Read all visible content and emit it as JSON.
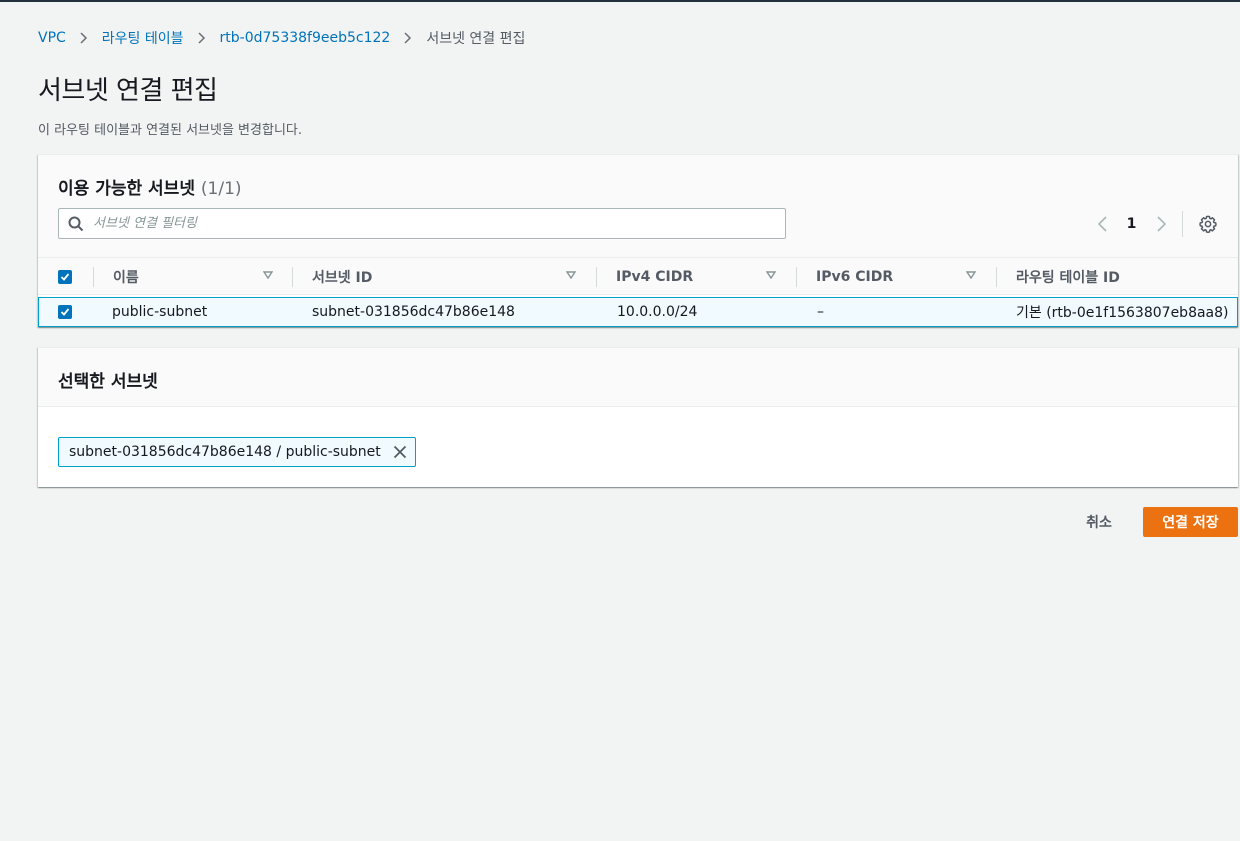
{
  "breadcrumb": {
    "items": [
      "VPC",
      "라우팅 테이블",
      "rtb-0d75338f9eeb5c122"
    ],
    "current": "서브넷 연결 편집"
  },
  "page": {
    "title": "서브넷 연결 편집",
    "description": "이 라우팅 테이블과 연결된 서브넷을 변경합니다."
  },
  "available_subnets": {
    "title": "이용 가능한 서브넷",
    "count": "(1/1)",
    "search_placeholder": "서브넷 연결 필터링",
    "page_number": "1",
    "columns": [
      "이름",
      "서브넷 ID",
      "IPv4 CIDR",
      "IPv6 CIDR",
      "라우팅 테이블 ID"
    ],
    "rows": [
      {
        "checked": true,
        "name": "public-subnet",
        "subnet_id": "subnet-031856dc47b86e148",
        "ipv4_cidr": "10.0.0.0/24",
        "ipv6_cidr": "–",
        "route_table_id": "기본 (rtb-0e1f1563807eb8aa8)"
      }
    ]
  },
  "selected_subnets": {
    "title": "선택한 서브넷",
    "tokens": [
      "subnet-031856dc47b86e148 / public-subnet"
    ]
  },
  "actions": {
    "cancel_label": "취소",
    "save_label": "연결 저장"
  },
  "colors": {
    "link": "#0073bb",
    "primary_button": "#ec7211",
    "selected_row_bg": "#f1faff",
    "selected_border": "#00a1c9"
  },
  "icons": [
    "chevron-right-icon",
    "search-icon",
    "chevron-left-icon",
    "gear-icon",
    "sort-down-icon",
    "check-icon",
    "close-icon"
  ]
}
